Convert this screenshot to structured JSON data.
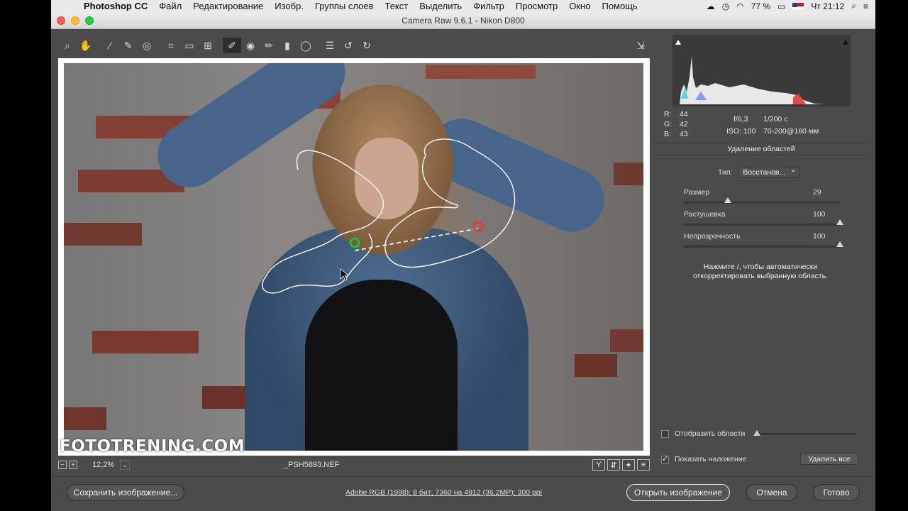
{
  "menubar": {
    "app": "Photoshop CC",
    "items": [
      "Файл",
      "Редактирование",
      "Изобр.",
      "Группы слоев",
      "Текст",
      "Выделить",
      "Фильтр",
      "Просмотр",
      "Окно",
      "Помощь"
    ],
    "battery": "77 %",
    "clock": "Чт 21:12"
  },
  "window": {
    "title": "Camera Raw 9.6.1  -  Nikon D800"
  },
  "photo": {
    "watermark": "FOTOTRENING.COM"
  },
  "statusbar": {
    "zoom": "12,2%",
    "filename": "_PSH5893.NEF",
    "view_buttons": [
      "Y",
      "⇵",
      "✦",
      "≡"
    ]
  },
  "info": {
    "r_label": "R:",
    "r": "44",
    "g_label": "G:",
    "g": "42",
    "b_label": "B:",
    "b": "43",
    "aperture": "f/6,3",
    "shutter": "1/200 с",
    "iso": "ISO: 100",
    "lens": "70-200@160 мм"
  },
  "panel": {
    "title": "Удаление областей",
    "type_label": "Тип:",
    "type_value": "Восстанов...",
    "sliders": [
      {
        "label": "Размер",
        "value": "29",
        "level": 0.28
      },
      {
        "label": "Растушевка",
        "value": "100",
        "level": 1.0
      },
      {
        "label": "Непрозрачность",
        "value": "100",
        "level": 1.0
      }
    ],
    "hint_line1": "Нажмите /, чтобы автоматически",
    "hint_line2": "откорректировать выбранную область.",
    "show_areas_label": "Отобразить области",
    "show_overlay_label": "Показать наложение",
    "delete_all": "Удалить все"
  },
  "bottom": {
    "save": "Сохранить изображение...",
    "workflow": "Adobe RGB (1998); 8 бит; 7360 на 4912 (36,2MP); 300 ppi",
    "open": "Открыть изображение",
    "cancel": "Отмена",
    "done": "Готово"
  }
}
